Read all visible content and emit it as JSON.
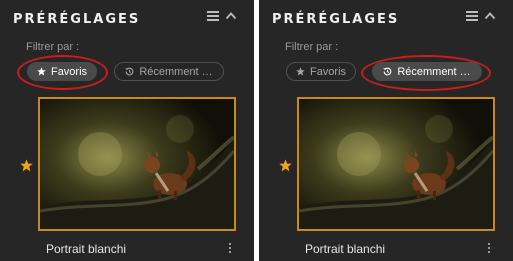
{
  "panels": [
    {
      "title": "PRÉRÉGLAGES",
      "filter_label": "Filtrer par :",
      "chips": [
        {
          "label": "Favoris",
          "icon": "star-icon",
          "state": "active"
        },
        {
          "label": "Récemment …",
          "icon": "history-icon",
          "state": "inactive"
        }
      ],
      "preset": {
        "name": "Portrait blanchi",
        "favorite": true
      }
    },
    {
      "title": "PRÉRÉGLAGES",
      "filter_label": "Filtrer par :",
      "chips": [
        {
          "label": "Favoris",
          "icon": "star-icon",
          "state": "inactive"
        },
        {
          "label": "Récemment …",
          "icon": "history-icon",
          "state": "active"
        }
      ],
      "preset": {
        "name": "Portrait blanchi",
        "favorite": true
      }
    }
  ],
  "colors": {
    "panel_bg": "#262626",
    "accent_orange": "#c98a1a",
    "highlight_red": "#c81e1e",
    "favorite_star": "#f0a11a"
  }
}
